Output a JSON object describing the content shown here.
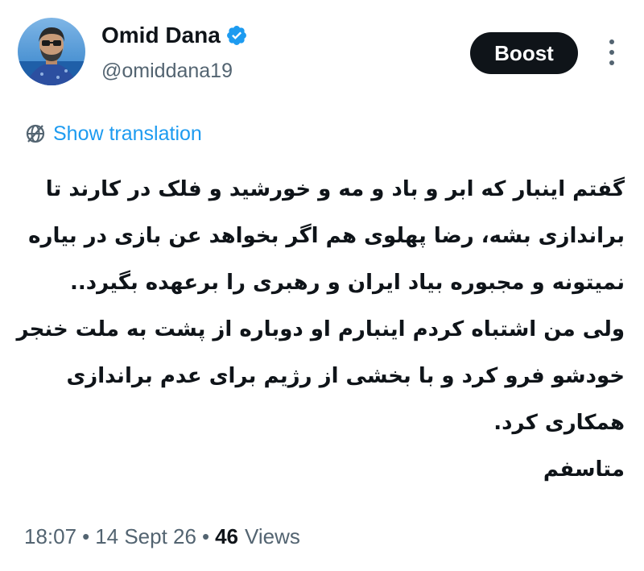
{
  "author": {
    "name": "Omid Dana",
    "handle": "@omiddana19",
    "verified": true,
    "verified_color": "#1d9bf0",
    "avatar": "profile-photo"
  },
  "actions": {
    "boost_label": "Boost",
    "more_icon": "more-vertical-icon"
  },
  "translation": {
    "label": "Show translation",
    "icon": "globe-icon",
    "color": "#1d9bf0"
  },
  "tweet": {
    "lines": [
      "گفتم اینبار که ابر و باد و مه و خورشید و فلک در کارند تا",
      "براندازی بشه، رضا پهلوی هم اگر بخواهد عن بازی در بیاره",
      "نمیتونه و مجبوره بیاد ایران و رهبری را برعهده بگیرد..",
      "ولی من اشتباه کردم اینبارم او دوباره از پشت به ملت خنجر",
      "خودشو فرو کرد و با بخشی از رژیم برای عدم براندازی",
      "همکاری کرد.",
      "متاسفم"
    ]
  },
  "meta": {
    "time": "18:07",
    "separator": "•",
    "date": "14 Sept 26",
    "views_count": "46",
    "views_label": "Views"
  }
}
